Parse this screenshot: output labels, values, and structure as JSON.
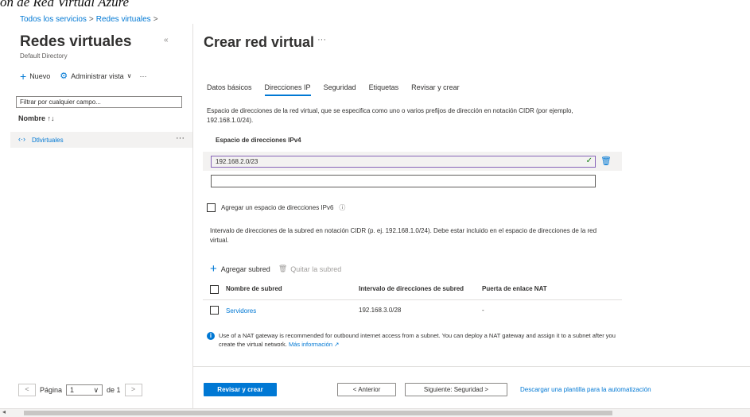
{
  "caption": "ón de Red Virtual Azure",
  "breadcrumb": {
    "item1": "Todos los servicios",
    "separator": ">",
    "item2": "Redes virtuales",
    "trailing": ">"
  },
  "left_blade": {
    "title": "Redes virtuales",
    "subtitle": "Default Directory",
    "collapse_icon": "«",
    "toolbar": {
      "new_label": "Nuevo",
      "manage_view_label": "Administrar vista",
      "more": "···"
    },
    "filter_placeholder": "Filtrar por cualquier campo...",
    "column_header": "Nombre ↑↓",
    "items": [
      {
        "label": "Dtlvirtuales",
        "more": "···"
      }
    ],
    "pager": {
      "prev": "<",
      "page_label": "Página",
      "page_value": "1",
      "of_label": "de 1",
      "next": ">"
    }
  },
  "main": {
    "title": "Crear red virtual",
    "more": "···",
    "tabs": [
      "Datos básicos",
      "Direcciones IP",
      "Seguridad",
      "Etiquetas",
      "Revisar y crear"
    ],
    "active_tab": "Direcciones IP",
    "address_space_desc": "Espacio de direcciones de la red virtual, que se especifica como uno o varios prefijos de dirección en notación CIDR (por ejemplo, 192.168.1.0/24).",
    "ipv4_label": "Espacio de direcciones IPv4",
    "ipv4_value": "192.168.2.0/23",
    "ipv4_empty_value": "",
    "ipv6_checkbox_label": "Agregar un espacio de direcciones IPv6",
    "ipv6_info_icon": "ⓘ",
    "subnet_desc": "Intervalo de direcciones de la subred en notación CIDR (p. ej. 192.168.1.0/24). Debe estar incluido en el espacio de direcciones de la red virtual.",
    "add_subnet_label": "Agregar subred",
    "remove_subnet_label": "Quitar la subred",
    "table": {
      "headers": [
        "Nombre de subred",
        "Intervalo de direcciones de subred",
        "Puerta de enlace NAT"
      ],
      "rows": [
        {
          "name": "Servidores",
          "range": "192.168.3.0/28",
          "nat": "-"
        }
      ]
    },
    "info_text": "Use of a NAT gateway is recommended for outbound internet access from a subnet. You can deploy a NAT gateway and assign it to a subnet after you create the virtual network.",
    "info_link": "Más información",
    "info_link_icon": "↗"
  },
  "footer": {
    "review_create": "Revisar y crear",
    "previous": "< Anterior",
    "next": "Siguiente: Seguridad >",
    "download_template": "Descargar una plantilla para la automatización"
  },
  "colors": {
    "accent": "#0078d4",
    "selected_row": "#f3f2f1",
    "valid_check": "#107c10",
    "input_focus": "#8764b8"
  }
}
